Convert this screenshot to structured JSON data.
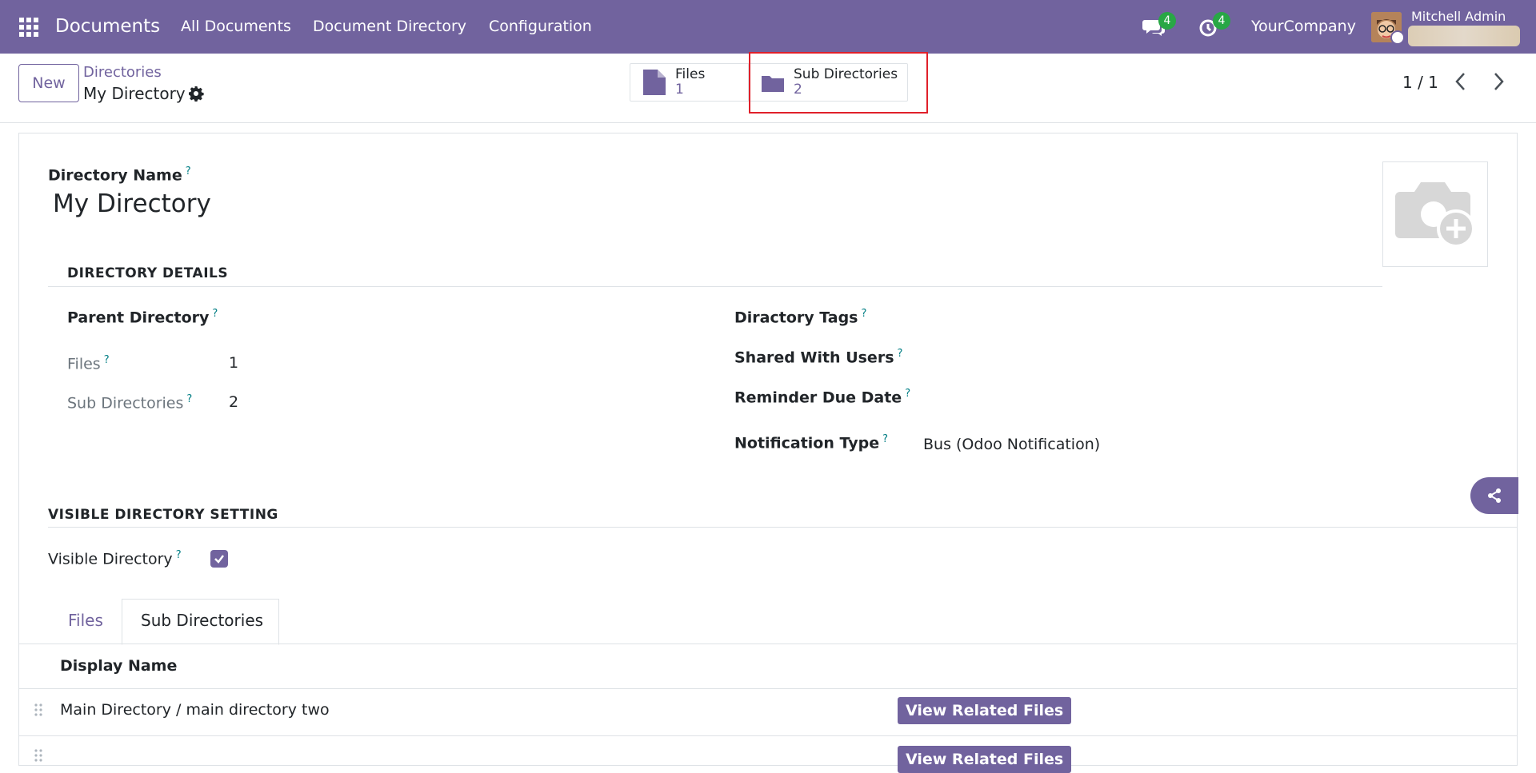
{
  "navbar": {
    "app_name": "Documents",
    "menu": [
      "All Documents",
      "Document Directory",
      "Configuration"
    ],
    "messages_count": "4",
    "activities_count": "4",
    "company": "YourCompany",
    "user_name": "Mitchell Admin"
  },
  "control_panel": {
    "new_label": "New",
    "breadcrumb_parent": "Directories",
    "breadcrumb_current": "My Directory",
    "smart_buttons": [
      {
        "label": "Files",
        "value": "1",
        "icon": "file-icon"
      },
      {
        "label": "Sub Directories",
        "value": "2",
        "icon": "folder-icon"
      }
    ],
    "pager": "1 / 1"
  },
  "form": {
    "name_label": "Directory Name",
    "name_value": "My Directory",
    "section_details": "DIRECTORY DETAILS",
    "parent_directory_label": "Parent Directory",
    "files_label": "Files",
    "files_value": "1",
    "sub_directories_label": "Sub Directories",
    "sub_directories_value": "2",
    "tags_label": "Diractory Tags",
    "shared_users_label": "Shared With Users",
    "reminder_label": "Reminder Due Date",
    "notification_label": "Notification Type",
    "notification_value": "Bus (Odoo Notification)",
    "section_visible": "VISIBLE DIRECTORY SETTING",
    "visible_label": "Visible Directory",
    "visible_checked": true,
    "help_mark": "?"
  },
  "tabs": {
    "items": [
      "Files",
      "Sub Directories"
    ],
    "active": "Sub Directories"
  },
  "table": {
    "header": "Display Name",
    "rows": [
      {
        "name": "Main Directory / main directory two",
        "action": "View Related Files"
      },
      {
        "name": "",
        "action": "View Related Files"
      }
    ]
  },
  "colors": {
    "brand": "#71639e",
    "badge": "#28a745",
    "highlight": "#e0202a"
  }
}
